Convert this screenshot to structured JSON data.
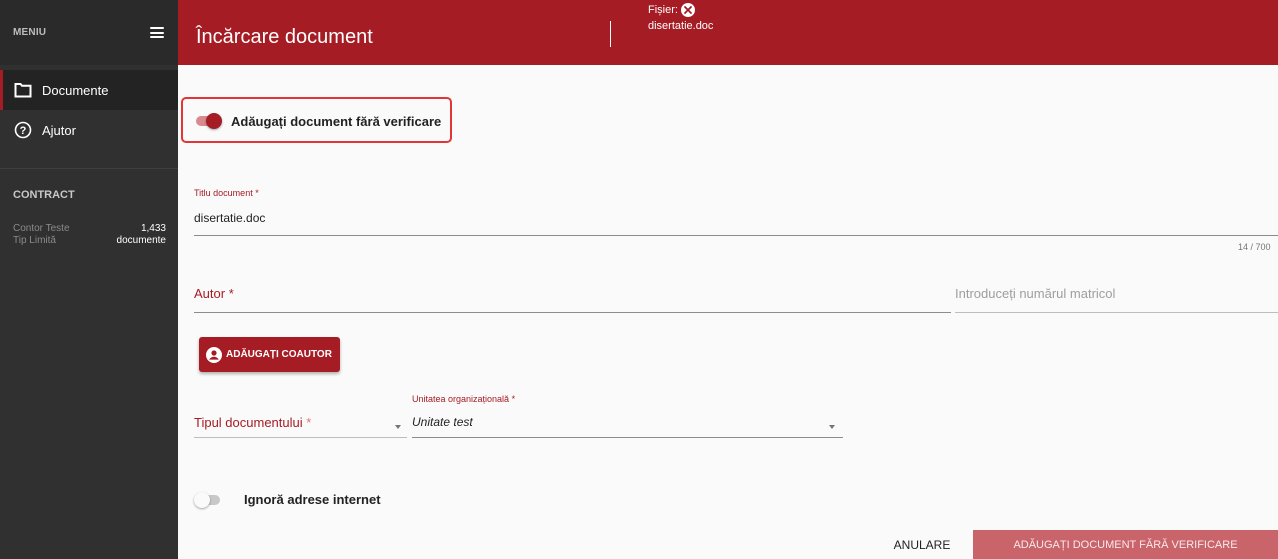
{
  "sidebar": {
    "menu_label": "MENIU",
    "items": [
      {
        "label": "Documente",
        "icon": "folder-icon",
        "active": true
      },
      {
        "label": "Ajutor",
        "icon": "help-circle-icon",
        "active": false
      }
    ],
    "section_title": "CONTRACT",
    "stats": [
      {
        "key": "Contor Teste",
        "value": "1,433"
      },
      {
        "key": "Tip Limită",
        "value": "documente"
      }
    ]
  },
  "header": {
    "title": "Încărcare document",
    "file_label": "Fișier:",
    "file_name": "disertatie.doc"
  },
  "form": {
    "no_check_toggle": {
      "label": "Adăugați document fără verificare",
      "on": true
    },
    "title_field": {
      "label": "Titlu document",
      "required_mark": "*",
      "value": "disertatie.doc",
      "counter": "14 / 700"
    },
    "author_field": {
      "placeholder": "Autor",
      "required_mark": "*"
    },
    "matricol_field": {
      "placeholder": "Introduceți numărul matricol"
    },
    "add_coauthor_button": "ADĂUGAȚI COAUTOR",
    "doc_type_field": {
      "placeholder": "Tipul documentului",
      "required_mark": "*"
    },
    "org_unit_field": {
      "label": "Unitatea organizațională",
      "required_mark": "*",
      "value": "Unitate test"
    },
    "ignore_urls_toggle": {
      "label": "Ignoră adrese internet",
      "on": false
    }
  },
  "actions": {
    "cancel_label": "ANULARE",
    "submit_label": "ADĂUGAȚI DOCUMENT FĂRĂ VERIFICARE"
  },
  "colors": {
    "primary": "#a51c24",
    "sidebar_bg": "#303030",
    "highlight_border": "#e03636",
    "submit_disabled_bg": "#c9646b"
  }
}
